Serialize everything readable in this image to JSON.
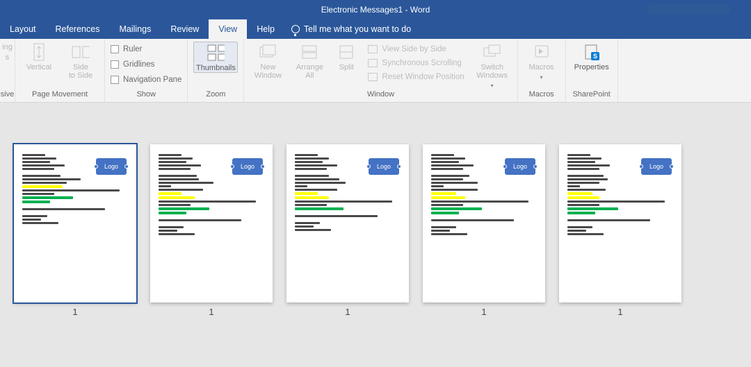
{
  "app": {
    "title": "Electronic Messages1  -  Word"
  },
  "tabs": {
    "layout": "Layout",
    "references": "References",
    "mailings": "Mailings",
    "review": "Review",
    "view": "View",
    "help": "Help",
    "tellme": "Tell me what you want to do"
  },
  "ribbon": {
    "page_movement": {
      "label": "Page Movement",
      "vertical": "Vertical",
      "side_to_side": "Side\nto Side",
      "cutleft1": "ing",
      "cutleft2": "s",
      "cutleft3": "sive"
    },
    "show": {
      "label": "Show",
      "ruler": "Ruler",
      "gridlines": "Gridlines",
      "navpane": "Navigation Pane"
    },
    "zoom": {
      "label": "Zoom",
      "thumbnails": "Thumbnails"
    },
    "window": {
      "label": "Window",
      "new_window": "New\nWindow",
      "arrange_all": "Arrange\nAll",
      "split": "Split",
      "side_by_side": "View Side by Side",
      "sync_scroll": "Synchronous Scrolling",
      "reset_pos": "Reset Window Position",
      "switch": "Switch\nWindows"
    },
    "macros": {
      "label": "Macros",
      "macros": "Macros"
    },
    "sharepoint": {
      "label": "SharePoint",
      "properties": "Properties"
    }
  },
  "thumbs": {
    "logo": "Logo",
    "numbers": [
      "1",
      "1",
      "1",
      "1",
      "1"
    ]
  }
}
